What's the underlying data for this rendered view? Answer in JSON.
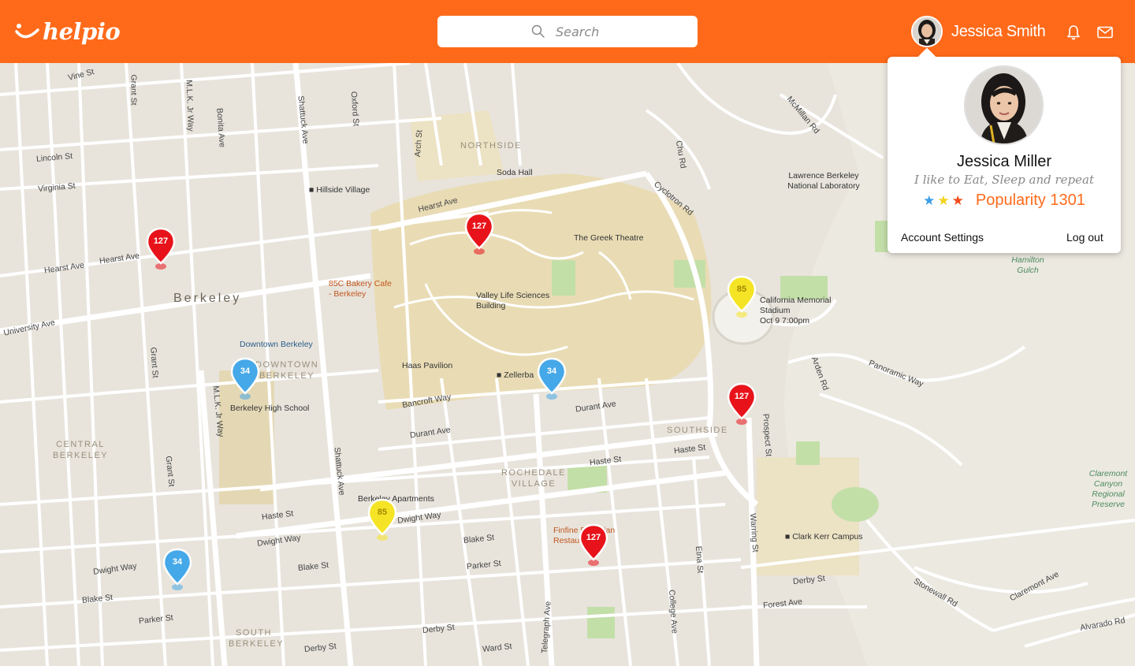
{
  "header": {
    "logo_text": "helpio",
    "search_placeholder": "Search",
    "user_name": "Jessica Smith"
  },
  "profile_popover": {
    "name": "Jessica Miller",
    "bio": "I like to Eat, Sleep and repeat",
    "stars": [
      {
        "icon": "star-icon",
        "color": "#3b9fe8"
      },
      {
        "icon": "star-icon",
        "color": "#f2d31b"
      },
      {
        "icon": "star-icon",
        "color": "#f24b1a"
      }
    ],
    "popularity": "Popularity 1301",
    "account_settings": "Account Settings",
    "logout": "Log out"
  },
  "map": {
    "city": "Berkeley",
    "districts": [
      "NORTHSIDE",
      "DOWNTOWN BERKELEY",
      "CENTRAL BERKELEY",
      "SOUTHSIDE",
      "ROCHEDALE VILLAGE",
      "SOUTH BERKELEY"
    ],
    "streets": [
      "Vine St",
      "Grant St",
      "M.L.K. Jr Way",
      "Bonita Ave",
      "Shattuck Ave",
      "Oxford St",
      "Arch St",
      "Lincoln St",
      "Virginia St",
      "Hearst Ave",
      "Hearst Ave",
      "Hearst Ave",
      "University Ave",
      "Grant St",
      "M.L.K. Jr Way",
      "Shattuck Ave",
      "Bancroft Way",
      "Durant Ave",
      "Durant Ave",
      "Haste St",
      "Haste St",
      "Haste St",
      "Dwight Way",
      "Dwight Way",
      "Dwight Way",
      "Blake St",
      "Blake St",
      "Blake St",
      "Parker St",
      "Parker St",
      "Derby St",
      "Derby St",
      "Derby St",
      "Ward St",
      "Telegraph Ave",
      "College Ave",
      "Etna St",
      "Warring St",
      "Prospect St",
      "Forest Ave",
      "Stonewall Rd",
      "Claremont Ave",
      "Alvarado Rd",
      "Panoramic Way",
      "Arden Rd",
      "Cyclotron Rd",
      "Chu Rd",
      "McMillan Rd",
      "Grant St"
    ],
    "places": [
      "Soda Hall",
      "Hillside Village",
      "The Greek Theatre",
      "85C Bakery Cafe - Berkeley",
      "Valley Life Sciences Building",
      "Downtown Berkeley",
      "Haas Pavilion",
      "Zellerba",
      "Berkeley High School",
      "California Memorial Stadium",
      "Oct 9 7:00pm",
      "Lawrence Berkeley National Laboratory",
      "Hamilton Gulch",
      "Clark Kerr Campus",
      "Berkeley Apartments",
      "Finfine Ethiopian Restaurant",
      "Claremont Canyon Regional Preserve"
    ],
    "pins": [
      {
        "count": "127",
        "color": "red"
      },
      {
        "count": "127",
        "color": "red"
      },
      {
        "count": "85",
        "color": "yellow"
      },
      {
        "count": "34",
        "color": "blue"
      },
      {
        "count": "34",
        "color": "blue"
      },
      {
        "count": "127",
        "color": "red"
      },
      {
        "count": "85",
        "color": "yellow"
      },
      {
        "count": "127",
        "color": "red"
      },
      {
        "count": "34",
        "color": "blue"
      }
    ]
  },
  "colors": {
    "brand": "#ff6a1a",
    "pin_red": "#e8131a",
    "pin_yellow": "#f5e425",
    "pin_blue": "#45a8e8",
    "campus": "#e9dcb5",
    "park": "#c3dfa8"
  }
}
